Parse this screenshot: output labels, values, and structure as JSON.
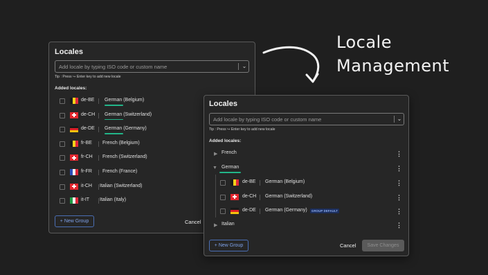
{
  "annotation": {
    "line1": "Locale",
    "line2": "Management"
  },
  "back_panel": {
    "title": "Locales",
    "search_placeholder": "Add locale by typing ISO code or custom name",
    "tip": "Tip : Press ↪ Enter key to add new locale",
    "section_label": "Added locales:",
    "locales": [
      {
        "code": "de-BE",
        "name": "German (Belgium)",
        "flag": "be",
        "underline": true
      },
      {
        "code": "de-CH",
        "name": "German (Switzerland)",
        "flag": "ch",
        "underline": true
      },
      {
        "code": "de-DE",
        "name": "German (Germany)",
        "flag": "de",
        "underline": true
      },
      {
        "code": "fr-BE",
        "name": "French (Belgium)",
        "flag": "be",
        "underline": false
      },
      {
        "code": "fr-CH",
        "name": "French (Switzerland)",
        "flag": "ch",
        "underline": false
      },
      {
        "code": "fr-FR",
        "name": "French (France)",
        "flag": "fr",
        "underline": false
      },
      {
        "code": "it-CH",
        "name": "Italian (Switzerland)",
        "flag": "ch",
        "underline": false
      },
      {
        "code": "it-IT",
        "name": "Italian (Italy)",
        "flag": "it",
        "underline": false
      }
    ],
    "new_group_label": "+ New Group",
    "cancel_label": "Cancel"
  },
  "front_panel": {
    "title": "Locales",
    "search_placeholder": "Add locale by typing ISO code or custom name",
    "tip": "Tip : Press ↪ Enter key to add new locale",
    "section_label": "Added locales:",
    "groups": {
      "french": "French",
      "german": "German",
      "italian": "Italian"
    },
    "german_locales": [
      {
        "code": "de-BE",
        "name": "German (Belgium)",
        "flag": "be"
      },
      {
        "code": "de-CH",
        "name": "German (Switzerland)",
        "flag": "ch"
      },
      {
        "code": "de-DE",
        "name": "German (Germany)",
        "flag": "de",
        "badge": "GROUP DEFAULT"
      }
    ],
    "new_group_label": "+ New Group",
    "cancel_label": "Cancel",
    "save_label": "Save Changes"
  },
  "colors": {
    "accent_green": "#22b589",
    "accent_blue": "#4b6fb5"
  }
}
